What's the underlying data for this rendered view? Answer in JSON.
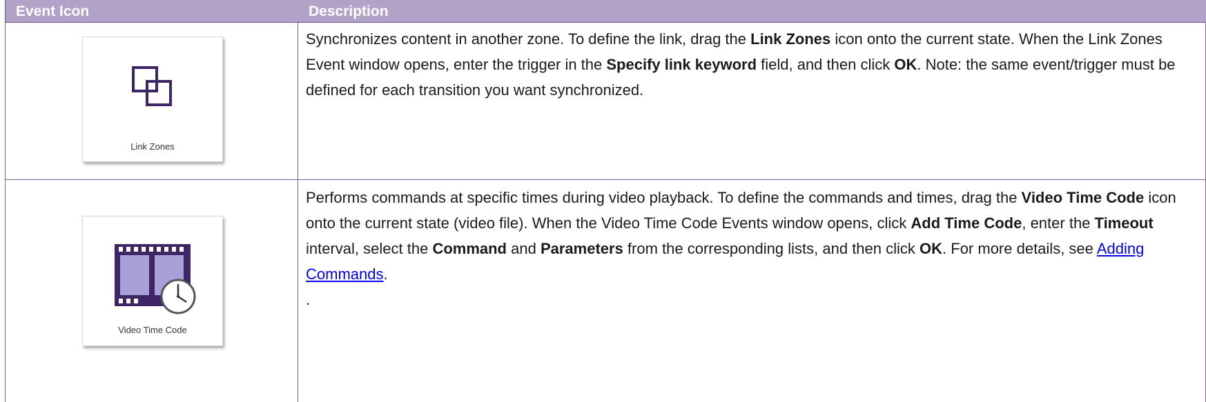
{
  "table": {
    "headers": [
      "Event Icon",
      "Description"
    ],
    "rows": [
      {
        "icon": {
          "name": "link-zones-icon",
          "label": "Link Zones"
        },
        "description": [
          {
            "t": "Synchronizes content in another zone. To define the link, drag the "
          },
          {
            "b": "Link Zones"
          },
          {
            "t": " icon onto the current state. When the Link Zones Event window opens, enter the trigger in the "
          },
          {
            "b": "Specify link keyword"
          },
          {
            "t": " field, and then click "
          },
          {
            "b": "OK"
          },
          {
            "t": ". Note: the same event/trigger must be defined for each transition you want synchronized."
          }
        ]
      },
      {
        "icon": {
          "name": "video-time-code-icon",
          "label": "Video Time Code"
        },
        "description": [
          {
            "t": "Performs commands at specific times during video playback. To define the commands and times, drag the "
          },
          {
            "b": "Video Time Code"
          },
          {
            "t": " icon onto the current state (video file). When the Video Time Code Events window opens, click "
          },
          {
            "b": "Add Time Code"
          },
          {
            "t": ", enter the "
          },
          {
            "b": "Timeout"
          },
          {
            "t": " interval, select the "
          },
          {
            "b": "Command"
          },
          {
            "t": " and "
          },
          {
            "b": "Parameters"
          },
          {
            "t": " from the corresponding lists, and then click "
          },
          {
            "b": "OK"
          },
          {
            "t": ". For more details, see "
          },
          {
            "a": "Adding Commands"
          },
          {
            "t": "."
          }
        ],
        "trailing": "."
      }
    ]
  },
  "colors": {
    "header_bg": "#b3a2c7",
    "border": "#7b5fa3",
    "icon_purple": "#3d2566",
    "link": "#0000ee"
  }
}
